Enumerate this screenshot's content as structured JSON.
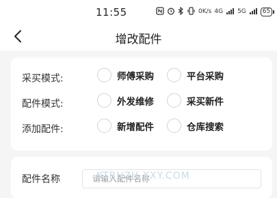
{
  "status_bar": {
    "time": "11:55",
    "icons": [
      "nfc-icon",
      "alarm-icon",
      "bluetooth-icon",
      "vibrate-icon",
      "data-speed-icon",
      "wifi-icon",
      "signal-icon",
      "battery-icon"
    ],
    "data_speed": "0",
    "data_speed_unit": "K/s",
    "network_1": "4G",
    "network_2": "5G",
    "battery_level": "65"
  },
  "nav": {
    "title": "增改配件"
  },
  "modes": {
    "rows": [
      {
        "label": "采买模式:",
        "option_a": "师傅采购",
        "option_b": "平台采购"
      },
      {
        "label": "配件模式:",
        "option_a": "外发维修",
        "option_b": "采买新件"
      },
      {
        "label": "添加配件:",
        "option_a": "新增配件",
        "option_b": "仓库搜索"
      }
    ]
  },
  "part_name": {
    "label": "配件名称",
    "value": "",
    "placeholder": "请输入配件名称"
  },
  "watermark": {
    "text": "KTBUZH.XXY.COM"
  }
}
